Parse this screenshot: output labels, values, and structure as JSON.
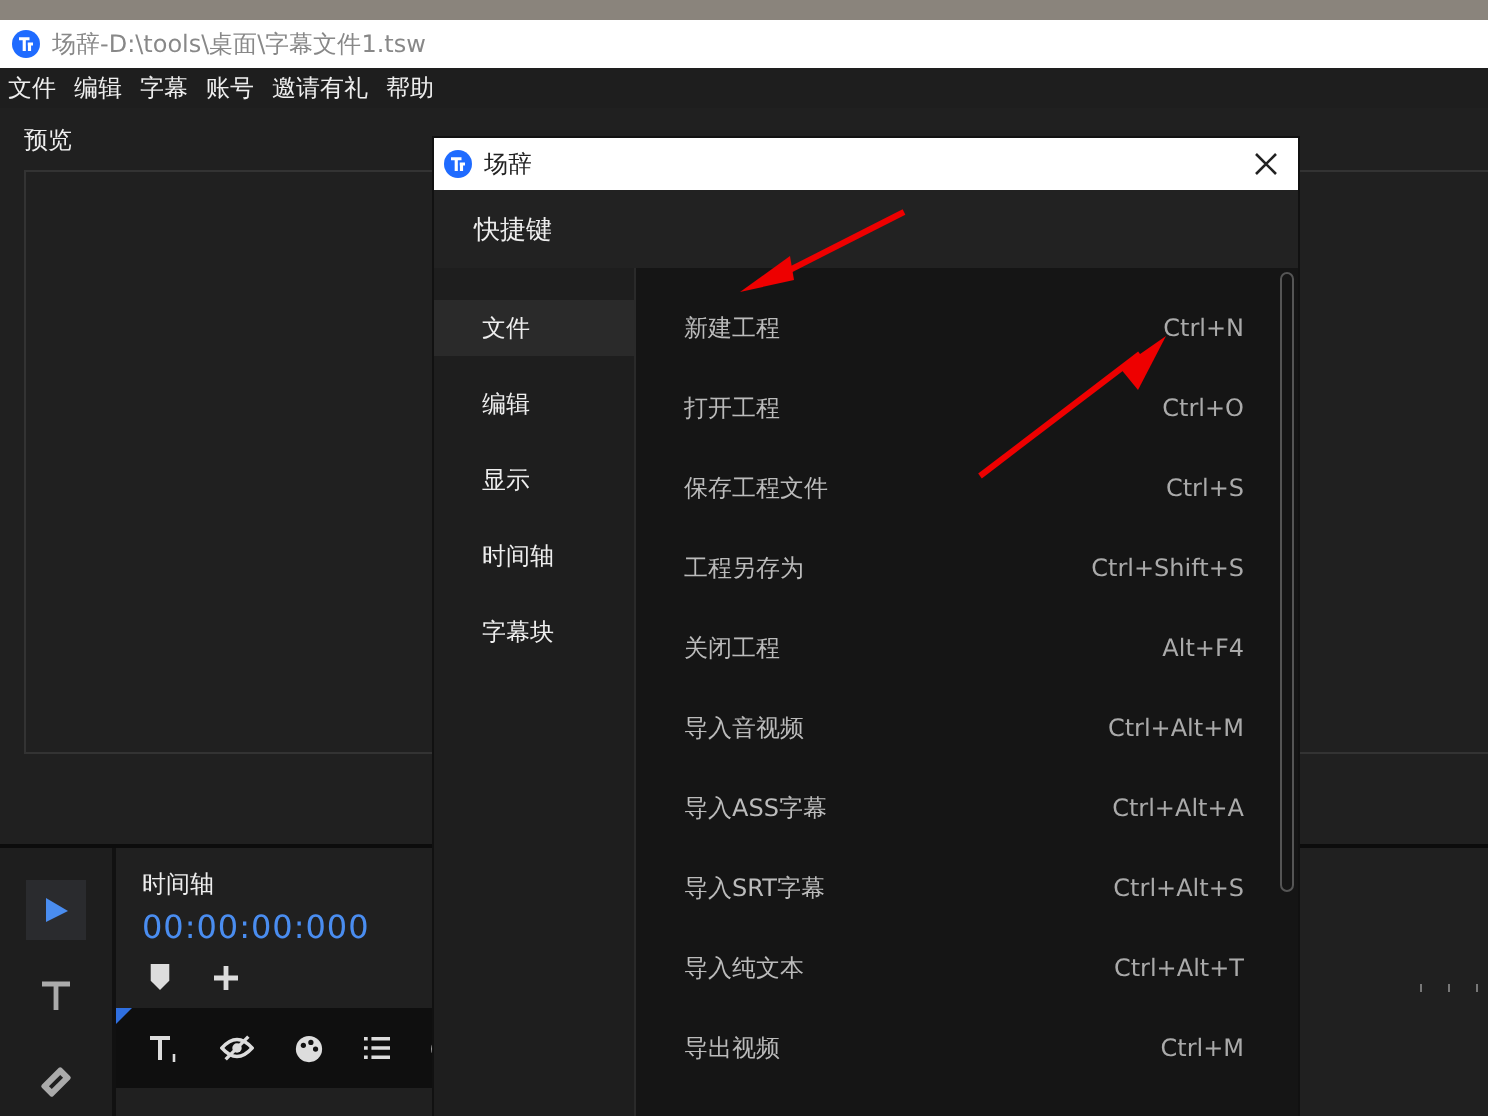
{
  "window": {
    "title": "场辞-D:\\tools\\桌面\\字幕文件1.tsw"
  },
  "menu": [
    "文件",
    "编辑",
    "字幕",
    "账号",
    "邀请有礼",
    "帮助"
  ],
  "preview": {
    "label": "预览"
  },
  "tools": [
    {
      "kind": "select",
      "selected": true
    },
    {
      "kind": "text",
      "selected": false
    },
    {
      "kind": "razor",
      "selected": false
    }
  ],
  "timeline": {
    "label": "时间轴",
    "time": "00:00:00:000"
  },
  "dialog": {
    "title": "场辞",
    "header": "快捷键",
    "nav": [
      {
        "label": "文件",
        "selected": true
      },
      {
        "label": "编辑",
        "selected": false
      },
      {
        "label": "显示",
        "selected": false
      },
      {
        "label": "时间轴",
        "selected": false
      },
      {
        "label": "字幕块",
        "selected": false
      }
    ],
    "shortcuts": [
      {
        "action": "新建工程",
        "keys": "Ctrl+N"
      },
      {
        "action": "打开工程",
        "keys": "Ctrl+O"
      },
      {
        "action": "保存工程文件",
        "keys": "Ctrl+S"
      },
      {
        "action": "工程另存为",
        "keys": "Ctrl+Shift+S"
      },
      {
        "action": "关闭工程",
        "keys": "Alt+F4"
      },
      {
        "action": "导入音视频",
        "keys": "Ctrl+Alt+M"
      },
      {
        "action": "导入ASS字幕",
        "keys": "Ctrl+Alt+A"
      },
      {
        "action": "导入SRT字幕",
        "keys": "Ctrl+Alt+S"
      },
      {
        "action": "导入纯文本",
        "keys": "Ctrl+Alt+T"
      },
      {
        "action": "导出视频",
        "keys": "Ctrl+M"
      }
    ]
  }
}
